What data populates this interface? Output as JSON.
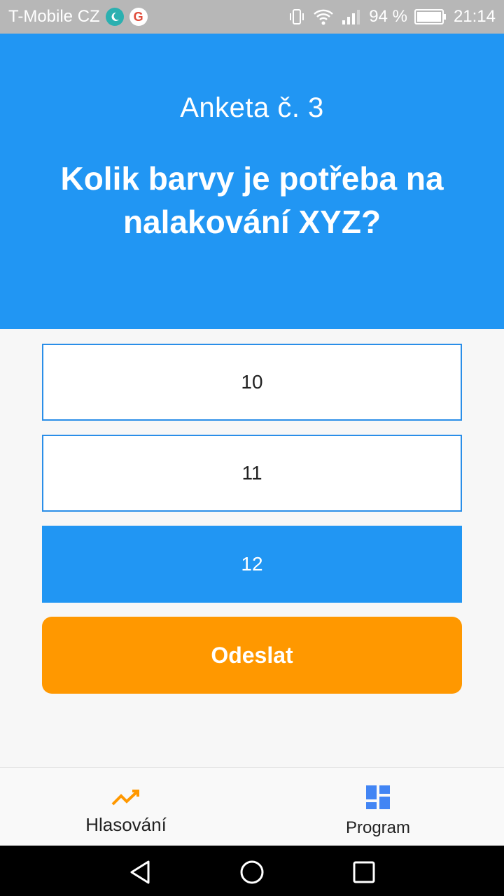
{
  "status_bar": {
    "carrier": "T-Mobile CZ",
    "battery": "94 %",
    "time": "21:14",
    "icons": [
      "moon-icon",
      "google-icon",
      "vibrate-icon",
      "wifi-icon",
      "signal-icon",
      "battery-icon"
    ]
  },
  "header": {
    "poll_label": "Anketa č. 3",
    "question": "Kolik barvy je potřeba na nalakování XYZ?"
  },
  "options": [
    {
      "label": "10",
      "selected": false
    },
    {
      "label": "11",
      "selected": false
    },
    {
      "label": "12",
      "selected": true
    }
  ],
  "submit_label": "Odeslat",
  "bottom_nav": {
    "items": [
      {
        "label": "Hlasování",
        "icon": "trending-up-icon",
        "active": true
      },
      {
        "label": "Program",
        "icon": "dashboard-icon",
        "active": false
      }
    ]
  },
  "system_nav": [
    "back-icon",
    "home-icon",
    "recents-icon"
  ],
  "colors": {
    "primary": "#2196F3",
    "accent": "#FF9800",
    "status_bar": "#B7B7B7",
    "background": "#F7F7F7"
  }
}
